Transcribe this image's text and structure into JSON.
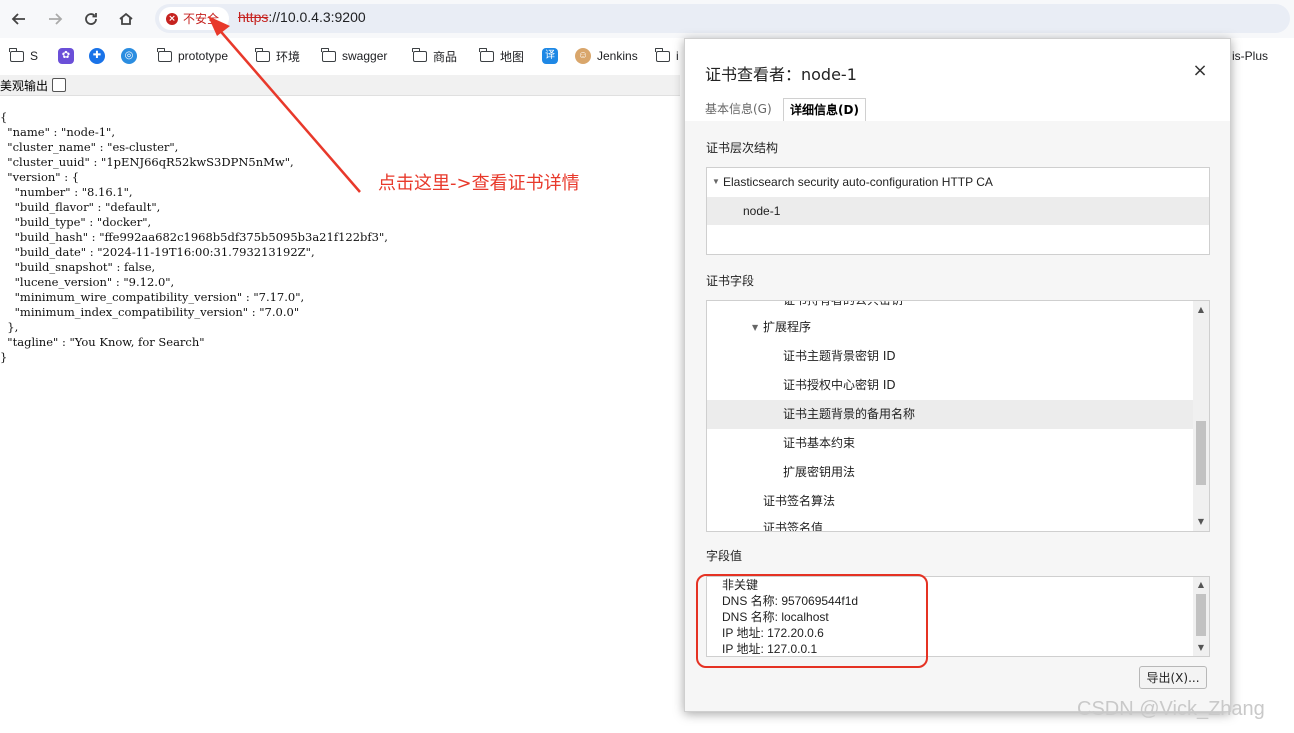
{
  "browser": {
    "security_label": "不安全",
    "url_protocol": "https",
    "url_rest": "://10.0.4.3:9200"
  },
  "bookmarks": [
    {
      "label": "S",
      "icon": "folder-icon"
    },
    {
      "label": "",
      "icon": "purple-app-icon"
    },
    {
      "label": "",
      "icon": "blue-app-icon"
    },
    {
      "label": "",
      "icon": "blue-swirl-icon"
    },
    {
      "label": "prototype",
      "icon": "folder-icon"
    },
    {
      "label": "环境",
      "icon": "folder-icon"
    },
    {
      "label": "swagger",
      "icon": "folder-icon"
    },
    {
      "label": "商品",
      "icon": "folder-icon"
    },
    {
      "label": "地图",
      "icon": "folder-icon"
    },
    {
      "label": "",
      "icon": "translate-icon"
    },
    {
      "label": "Jenkins",
      "icon": "jenkins-icon"
    },
    {
      "label": "i",
      "icon": "folder-icon"
    },
    {
      "label": "is-Plus",
      "icon": "red-app-icon"
    }
  ],
  "page": {
    "pretty_print_label": "美观输出",
    "json_lines": [
      "{",
      "  \"name\" : \"node-1\",",
      "  \"cluster_name\" : \"es-cluster\",",
      "  \"cluster_uuid\" : \"1pENJ66qR52kwS3DPN5nMw\",",
      "  \"version\" : {",
      "    \"number\" : \"8.16.1\",",
      "    \"build_flavor\" : \"default\",",
      "    \"build_type\" : \"docker\",",
      "    \"build_hash\" : \"ffe992aa682c1968b5df375b5095b3a21f122bf3\",",
      "    \"build_date\" : \"2024-11-19T16:00:31.793213192Z\",",
      "    \"build_snapshot\" : false,",
      "    \"lucene_version\" : \"9.12.0\",",
      "    \"minimum_wire_compatibility_version\" : \"7.17.0\",",
      "    \"minimum_index_compatibility_version\" : \"7.0.0\"",
      "  },",
      "  \"tagline\" : \"You Know, for Search\"",
      "}"
    ]
  },
  "annotation": {
    "text": "点击这里->查看证书详情",
    "color": "#e8392b"
  },
  "dialog": {
    "title": "证书查看者：node-1",
    "close": "×",
    "tabs": {
      "basic": "基本信息(G)",
      "detail": "详细信息(D)"
    },
    "hierarchy_label": "证书层次结构",
    "hierarchy": [
      {
        "label": "Elasticsearch security auto-configuration HTTP CA",
        "expanded": true
      },
      {
        "label": "node-1",
        "selected": true
      }
    ],
    "fields_label": "证书字段",
    "fields": [
      {
        "label": "证书持有者的公共密钥",
        "indent": 2
      },
      {
        "label": "扩展程序",
        "indent": 1,
        "expanded": true
      },
      {
        "label": "证书主题背景密钥 ID",
        "indent": 2
      },
      {
        "label": "证书授权中心密钥 ID",
        "indent": 2
      },
      {
        "label": "证书主题背景的备用名称",
        "indent": 2,
        "selected": true
      },
      {
        "label": "证书基本约束",
        "indent": 2
      },
      {
        "label": "扩展密钥用法",
        "indent": 2
      },
      {
        "label": "证书签名算法",
        "indent": 1
      },
      {
        "label": "证书签名值",
        "indent": 1
      }
    ],
    "value_label": "字段值",
    "value_lines": [
      "非关键",
      "DNS 名称: 957069544f1d",
      "DNS 名称: localhost",
      "IP 地址: 172.20.0.6",
      "IP 地址: 127.0.0.1"
    ],
    "export_label": "导出(X)..."
  },
  "watermark": "CSDN @Vick_Zhang"
}
